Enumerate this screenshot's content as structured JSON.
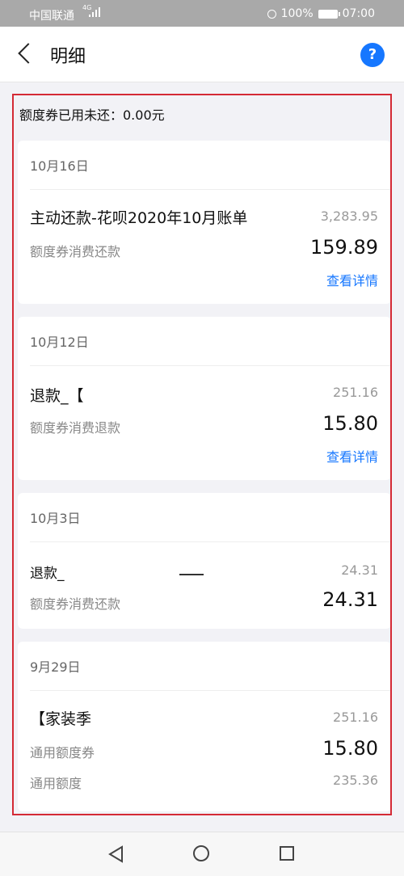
{
  "status_bar": {
    "carrier": "中国联通",
    "network": "4G",
    "battery": "100%",
    "time": "07:00"
  },
  "header": {
    "title": "明细",
    "help_label": "?"
  },
  "summary": {
    "text": "额度券已用未还：0.00元"
  },
  "records": [
    {
      "date": "10月16日",
      "name": "主动还款-花呗2020年10月账单",
      "total": "3,283.95",
      "sub_label": "额度券消费还款",
      "amount": "159.89",
      "link": "查看详情"
    },
    {
      "date": "10月12日",
      "name": "退款_【",
      "total": "251.16",
      "sub_label": "额度券消费退款",
      "amount": "15.80",
      "link": "查看详情"
    },
    {
      "date": "10月3日",
      "name": "退款_",
      "total": "24.31",
      "sub_label": "额度券消费还款",
      "amount": "24.31"
    },
    {
      "date": "9月29日",
      "name": "【家装季",
      "total": "251.16",
      "sub_label": "通用额度券",
      "amount": "15.80",
      "sub_label2": "通用额度",
      "amount2": "235.36"
    }
  ]
}
